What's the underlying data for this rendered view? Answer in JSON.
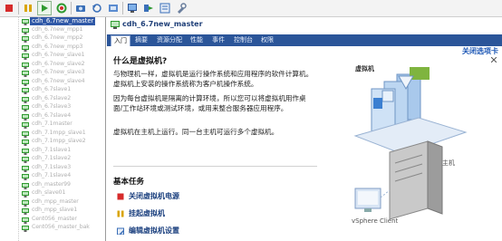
{
  "toolbar": {
    "buttons": [
      {
        "icon": "stop-icon",
        "color": "#d62b2b"
      },
      {
        "icon": "pause-icon",
        "color": "#d9a400"
      },
      {
        "icon": "play-icon",
        "color": "#2f9a2f"
      },
      {
        "icon": "refresh-icon",
        "color": "#2f9a2f"
      },
      {
        "icon": "snapshot-icon",
        "color": "#3a6fb8"
      },
      {
        "icon": "revert-snapshot-icon",
        "color": "#3a6fb8"
      },
      {
        "icon": "snapshot-manager-icon",
        "color": "#3a6fb8"
      },
      {
        "icon": "console-icon",
        "color": "#3a6fb8"
      },
      {
        "icon": "migrate-icon",
        "color": "#3a6fb8"
      },
      {
        "icon": "edit-settings-icon",
        "color": "#3a6fb8"
      },
      {
        "icon": "tools-icon",
        "color": "#3a6fb8"
      }
    ]
  },
  "tree": {
    "selected_index": 0,
    "items": [
      "cdh_6.7new_master",
      "cdh_6.7new_mpp1",
      "cdh_6.7new_mpp2",
      "cdh_6.7new_mpp3",
      "cdh_6.7new_slave1",
      "cdh_6.7new_slave2",
      "cdh_6.7new_slave3",
      "cdh_6.7new_slave4",
      "cdh_6.7slave1",
      "cdh_6.7slave2",
      "cdh_6.7slave3",
      "cdh_6.7slave4",
      "cdh_7.1master",
      "cdh_7.1mpp_slave1",
      "cdh_7.1mpp_slave2",
      "cdh_7.1slave1",
      "cdh_7.1slave2",
      "cdh_7.1slave3",
      "cdh_7.1slave4",
      "cdh_master99",
      "cdh_slave01",
      "cdh_mpp_master",
      "cdh_mpp_slave1",
      "Cent056_master",
      "Cent056_master_bak"
    ]
  },
  "panel": {
    "title": "cdh_6.7new_master",
    "tabs": [
      "入门",
      "摘要",
      "资源分配",
      "性能",
      "事件",
      "控制台",
      "权限"
    ],
    "active_tab": 0,
    "close_tab_link": "关闭选项卡",
    "heading": "什么是虚拟机?",
    "paragraphs": [
      "与物理机一样，虚拟机是运行操作系统和应用程序的软件计算机。虚拟机上安装的操作系统称为客户机操作系统。",
      "因为每台虚拟机是隔离的计算环境，所以您可以将虚拟机用作桌面/工作站环境或测试环境，或用来整合服务器应用程序。",
      "虚拟机在主机上运行。同一台主机可运行多个虚拟机。"
    ],
    "basic_tasks_heading": "基本任务",
    "tasks": [
      {
        "label": "关闭虚拟机电源",
        "icon": "power-off-icon",
        "color": "#d62b2b"
      },
      {
        "label": "挂起虚拟机",
        "icon": "suspend-icon",
        "color": "#d9a400"
      },
      {
        "label": "编辑虚拟机设置",
        "icon": "edit-settings-icon",
        "color": "#3a6fb8"
      }
    ],
    "diagram": {
      "vm_label": "虚拟机",
      "host_label": "主机",
      "client_label": "vSphere Client"
    }
  },
  "colors": {
    "tab_bar": "#2b5599",
    "selected_row": "#2f58a7",
    "link": "#1d57b5"
  }
}
